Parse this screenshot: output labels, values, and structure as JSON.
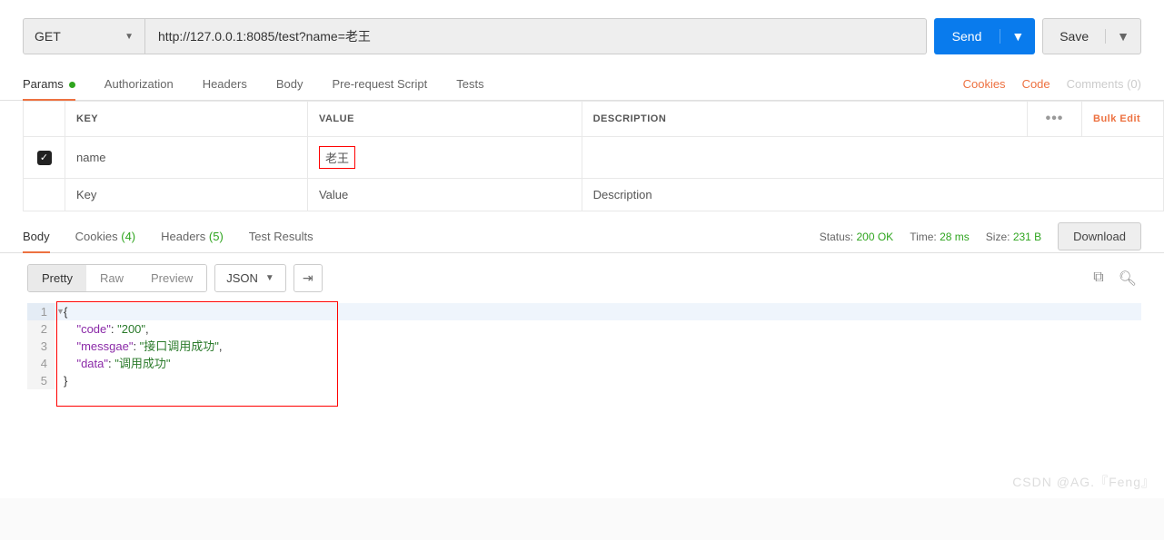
{
  "request": {
    "method": "GET",
    "url": "http://127.0.0.1:8085/test?name=老王",
    "send": "Send",
    "save": "Save"
  },
  "tabs": {
    "params": "Params",
    "auth": "Authorization",
    "headers": "Headers",
    "body": "Body",
    "prereq": "Pre-request Script",
    "tests": "Tests",
    "cookies": "Cookies",
    "code": "Code",
    "comments": "Comments (0)"
  },
  "params_table": {
    "key_h": "KEY",
    "val_h": "VALUE",
    "desc_h": "DESCRIPTION",
    "bulk": "Bulk Edit",
    "rows": [
      {
        "key": "name",
        "value": "老王",
        "desc": ""
      }
    ],
    "ph_key": "Key",
    "ph_val": "Value",
    "ph_desc": "Description"
  },
  "resp_tabs": {
    "body": "Body",
    "cookies": "Cookies",
    "cookies_n": "(4)",
    "headers": "Headers",
    "headers_n": "(5)",
    "test": "Test Results"
  },
  "status": {
    "status_l": "Status:",
    "status_v": "200 OK",
    "time_l": "Time:",
    "time_v": "28 ms",
    "size_l": "Size:",
    "size_v": "231 B",
    "download": "Download"
  },
  "format": {
    "pretty": "Pretty",
    "raw": "Raw",
    "preview": "Preview",
    "type": "JSON"
  },
  "response_body": {
    "code_key": "\"code\"",
    "code_val": "\"200\"",
    "msg_key": "\"messgae\"",
    "msg_val": "\"接口调用成功\"",
    "data_key": "\"data\"",
    "data_val": "\"调用成功\""
  },
  "watermark": "CSDN @AG.『Feng』"
}
